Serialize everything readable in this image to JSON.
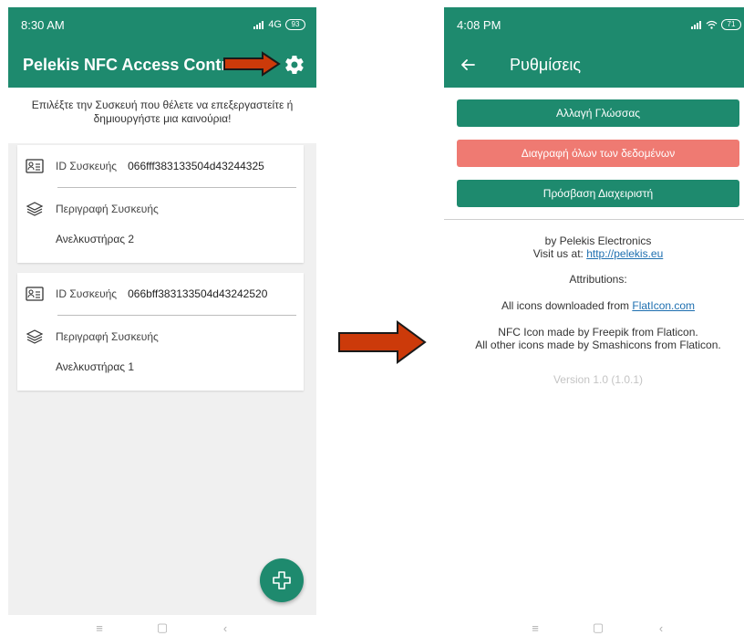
{
  "left_phone": {
    "status_time": "8:30 AM",
    "status_network": "4G",
    "status_battery": "93",
    "title": "Pelekis NFC Access Control",
    "intro_text": "Επιλέξτε την Συσκευή που θέλετε να επεξεργαστείτε ή δημιουργήστε μια καινούρια!",
    "devices": [
      {
        "id_label": "ID Συσκευής",
        "id_value": "066fff383133504d43244325",
        "desc_label": "Περιγραφή Συσκευής",
        "desc_value": "Ανελκυστήρας 2"
      },
      {
        "id_label": "ID Συσκευής",
        "id_value": "066bff383133504d43242520",
        "desc_label": "Περιγραφή Συσκευής",
        "desc_value": "Ανελκυστήρας 1"
      }
    ]
  },
  "right_phone": {
    "status_time": "4:08 PM",
    "status_battery": "71",
    "title": "Ρυθμίσεις",
    "buttons": {
      "language": "Αλλαγή Γλώσσας",
      "delete_all": "Διαγραφή όλων των δεδομένων",
      "admin": "Πρόσβαση Διαχειριστή"
    },
    "about": {
      "by": "by Pelekis Electronics",
      "visit_prefix": "Visit us at: ",
      "visit_link": "http://pelekis.eu",
      "attributions": "Attributions:",
      "icons_prefix": "All icons downloaded from ",
      "icons_link": "FlatIcon.com",
      "nfc_credit": "NFC Icon made by Freepik from Flaticon.",
      "other_credit": "All other icons made by Smashicons from Flaticon.",
      "version": "Version 1.0 (1.0.1)"
    }
  },
  "nav_icons": [
    "menu-icon",
    "home-square-icon",
    "back-chevron-icon"
  ],
  "colors": {
    "primary": "#1e8a6e",
    "danger": "#ef7a72",
    "arrow_fill": "#cc3a0a",
    "arrow_stroke": "#1a1a1a"
  }
}
